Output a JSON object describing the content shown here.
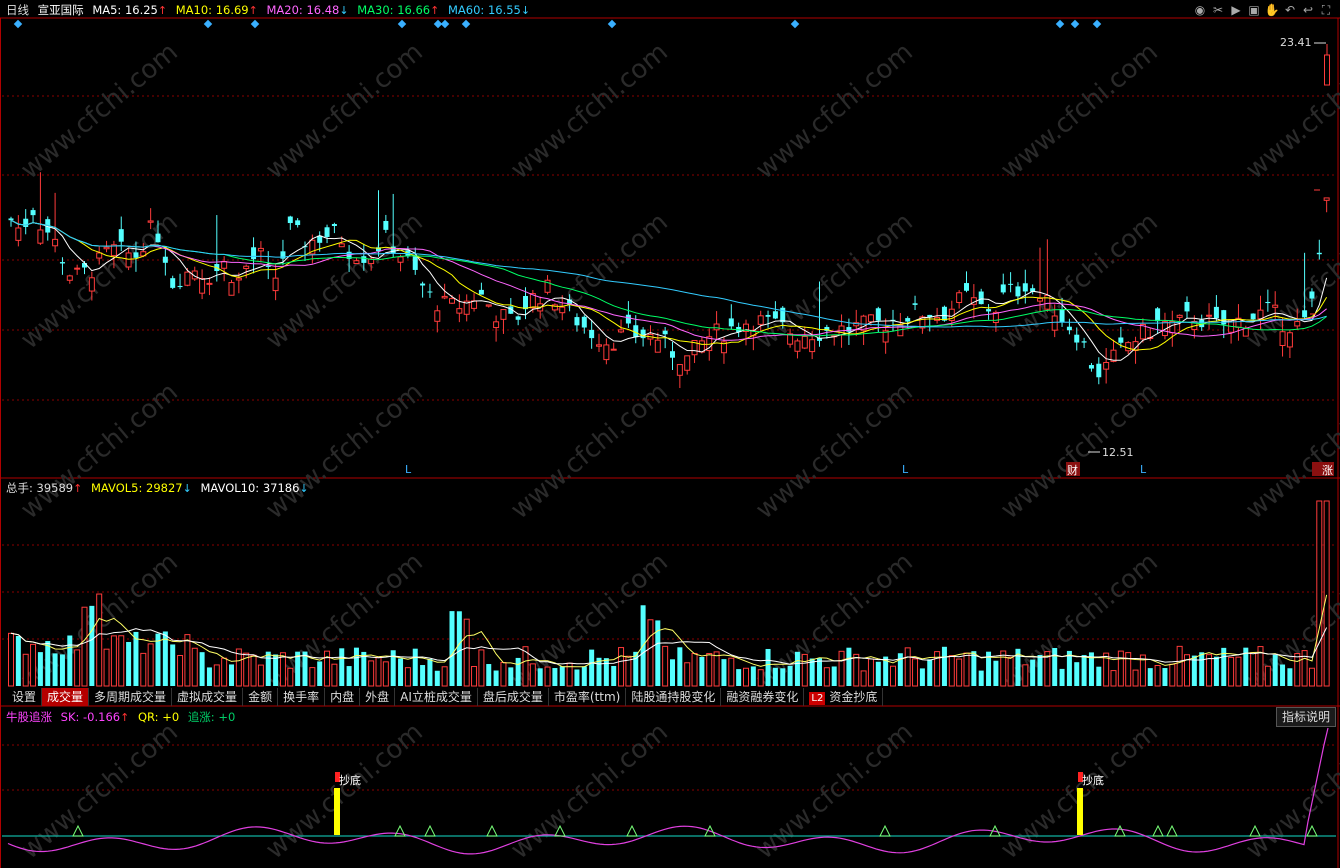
{
  "period_label": "日线",
  "stock_name": "宣亚国际",
  "ma": [
    {
      "label": "MA5: 16.25",
      "arrow": "↑",
      "color": "#ffffff"
    },
    {
      "label": "MA10: 16.69",
      "arrow": "↑",
      "color": "#ffff00"
    },
    {
      "label": "MA20: 16.48",
      "arrow": "↓",
      "color": "#ff66ff"
    },
    {
      "label": "MA30: 16.66",
      "arrow": "↑",
      "color": "#00ff66"
    },
    {
      "label": "MA60: 16.55",
      "arrow": "↓",
      "color": "#33ccff"
    }
  ],
  "price_labels": {
    "high": "23.41",
    "low": "12.51"
  },
  "markers": {
    "L": "L",
    "cai": "财",
    "zhangting": "涨"
  },
  "volume": {
    "total_label": "总手: 39589",
    "total_arrow": "↑",
    "mavol5_label": "MAVOL5: 29827",
    "mavol5_arrow": "↓",
    "mavol10_label": "MAVOL10: 37186",
    "mavol10_arrow": "↓"
  },
  "tabs": [
    {
      "label": "设置",
      "active": false,
      "badge": ""
    },
    {
      "label": "成交量",
      "active": true,
      "badge": ""
    },
    {
      "label": "多周期成交量",
      "active": false,
      "badge": ""
    },
    {
      "label": "虚拟成交量",
      "active": false,
      "badge": ""
    },
    {
      "label": "金额",
      "active": false,
      "badge": ""
    },
    {
      "label": "换手率",
      "active": false,
      "badge": ""
    },
    {
      "label": "内盘",
      "active": false,
      "badge": ""
    },
    {
      "label": "外盘",
      "active": false,
      "badge": ""
    },
    {
      "label": "AI立桩成交量",
      "active": false,
      "badge": ""
    },
    {
      "label": "盘后成交量",
      "active": false,
      "badge": ""
    },
    {
      "label": "市盈率(ttm)",
      "active": false,
      "badge": ""
    },
    {
      "label": "陆股通持股变化",
      "active": false,
      "badge": ""
    },
    {
      "label": "融资融券变化",
      "active": false,
      "badge": ""
    },
    {
      "label": "资金抄底",
      "active": false,
      "badge": "L2"
    }
  ],
  "indicator": {
    "name": "牛股追涨",
    "sk_label": "SK: -0.166",
    "sk_arrow": "↑",
    "qr_label": "QR: +0",
    "zz_label": "追涨: +0",
    "signal_text": "抄底",
    "help_label": "指标说明"
  },
  "watermark": "www.cfchi.com",
  "colors": {
    "up": "#ff3b3b",
    "down": "#54ffff",
    "grid": "#8a0000",
    "border": "#b00000"
  },
  "icons": [
    "eye-icon",
    "scissors-icon",
    "play-icon",
    "lock-icon",
    "hand-icon",
    "undo-icon",
    "back-icon",
    "expand-icon"
  ]
}
